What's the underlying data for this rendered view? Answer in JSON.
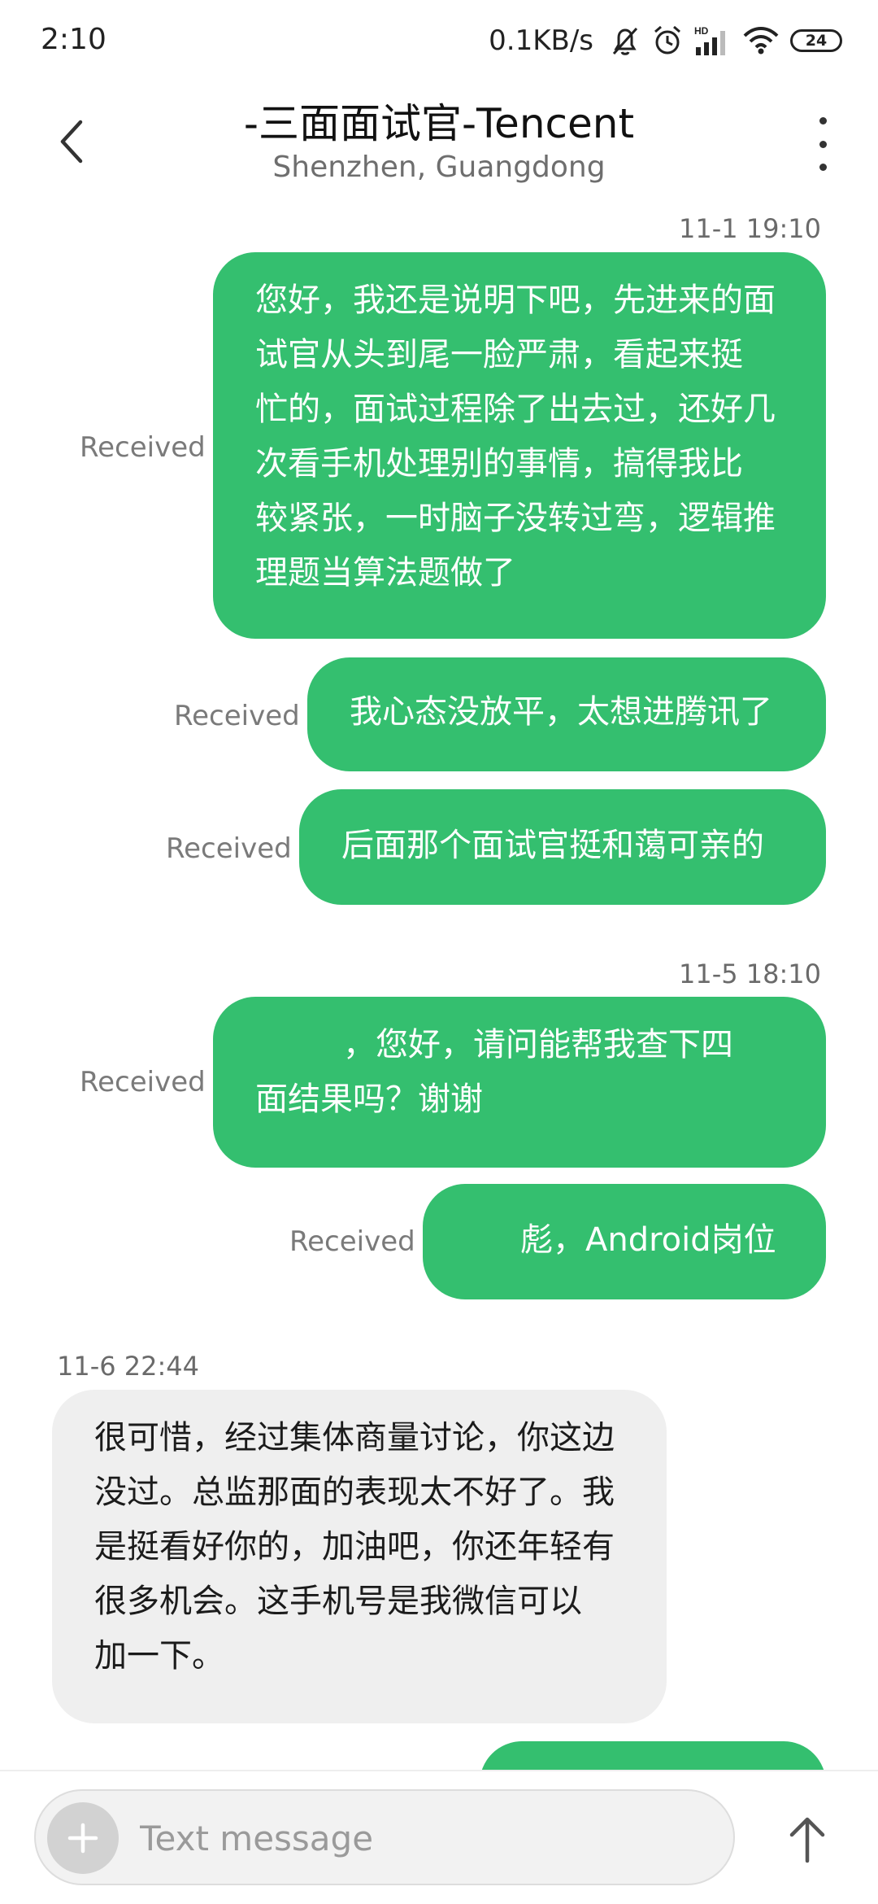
{
  "status_bar": {
    "time": "2:10",
    "net_speed": "0.1KB/s",
    "battery": "24",
    "icons": [
      "mute-bell-icon",
      "alarm-icon",
      "hd-signal-icon",
      "wifi-icon",
      "battery-icon"
    ]
  },
  "header": {
    "title": "-三面面试官-Tencent",
    "subtitle": "Shenzhen, Guangdong",
    "back_icon": "chevron-left-icon",
    "more_icon": "more-vertical-icon"
  },
  "colors": {
    "outgoing_bubble": "#34bf6f",
    "incoming_bubble": "#efefef"
  },
  "messages": {
    "ts1": "11-1 19:10",
    "m1": {
      "lines": [
        "您好，我还是说明下吧，先进来的面",
        "试官从头到尾一脸严肃，看起来挺",
        "忙的，面试过程除了出去过，还好几",
        "次看手机处理别的事情，搞得我比",
        "较紧张，一时脑子没转过弯，逻辑推",
        "理题当算法题做了"
      ],
      "status": "Received"
    },
    "m2": {
      "text": "我心态没放平，太想进腾讯了",
      "status": "Received"
    },
    "m3": {
      "text": "后面那个面试官挺和蔼可亲的",
      "status": "Received"
    },
    "ts2": "11-5 18:10",
    "m4": {
      "lines": [
        "，您好，请问能帮我查下四",
        "面结果吗？谢谢"
      ],
      "status": "Received"
    },
    "m5": {
      "text": "彪，Android岗位",
      "status": "Received"
    },
    "ts3": "11-6 22:44",
    "m6": {
      "lines": [
        "很可惜，经过集体商量讨论，你这边",
        "没过。总监那面的表现太不好了。我",
        "是挺看好你的，加油吧，你还年轻有",
        "很多机会。这手机号是我微信可以",
        "加一下。"
      ]
    }
  },
  "composer": {
    "placeholder": "Text message",
    "add_icon": "plus-icon",
    "send_icon": "arrow-up-icon"
  }
}
